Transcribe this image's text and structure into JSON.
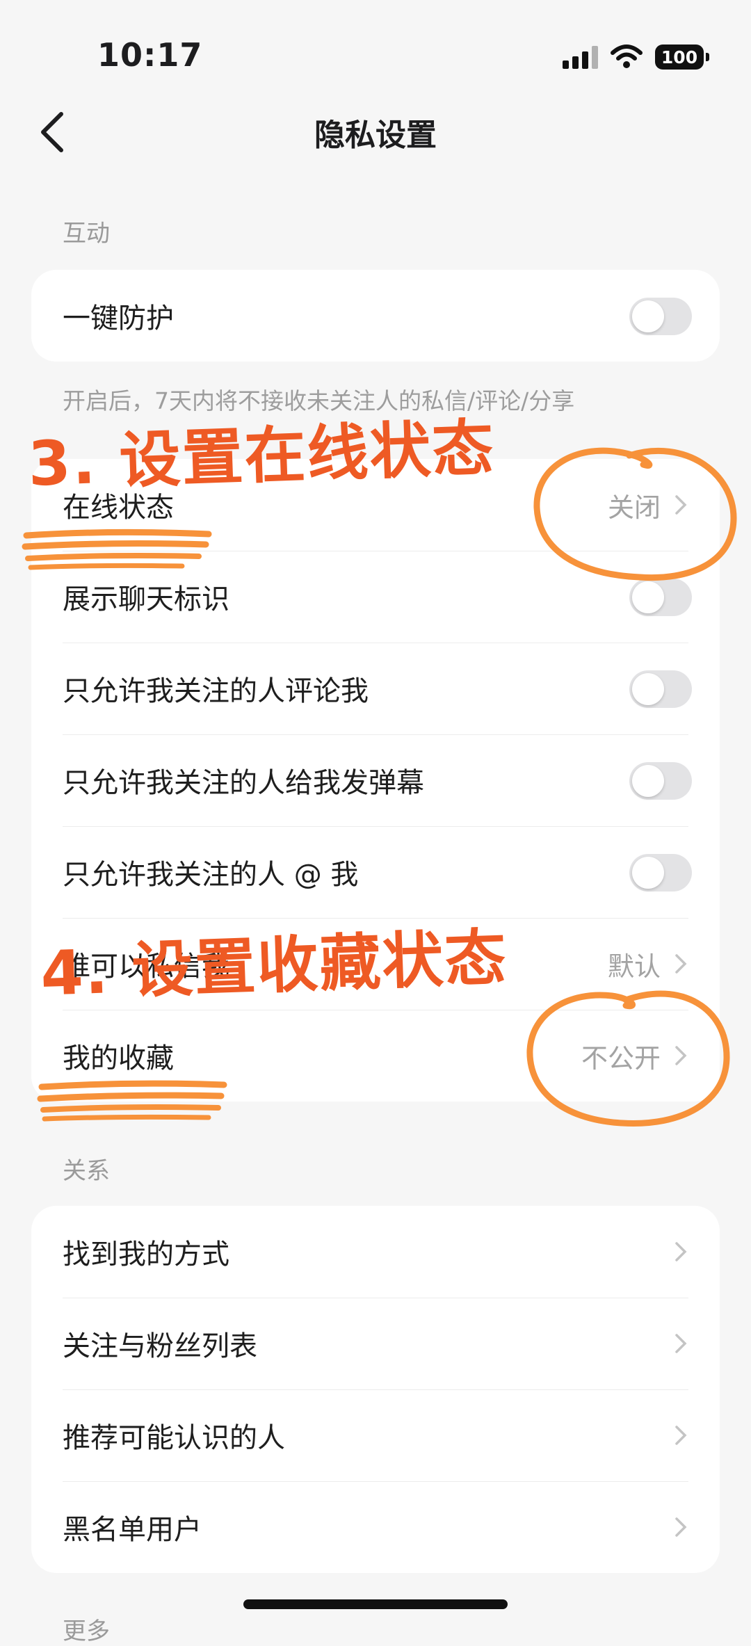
{
  "status_bar": {
    "time": "10:17",
    "battery": "100",
    "icons": [
      "signal-icon",
      "wifi-icon",
      "battery-icon"
    ]
  },
  "nav": {
    "title": "隐私设置",
    "back_icon": "chevron-left-icon"
  },
  "interaction": {
    "section_title": "互动",
    "protection": {
      "label": "一键防护",
      "enabled": false
    },
    "protection_helper": "开启后，7天内将不接收未关注人的私信/评论/分享",
    "items": [
      {
        "label": "在线状态",
        "value": "关闭",
        "type": "link"
      },
      {
        "label": "展示聊天标识",
        "type": "toggle",
        "enabled": false
      },
      {
        "label": "只允许我关注的人评论我",
        "type": "toggle",
        "enabled": false
      },
      {
        "label": "只允许我关注的人给我发弹幕",
        "type": "toggle",
        "enabled": false
      },
      {
        "label": "只允许我关注的人 @ 我",
        "type": "toggle",
        "enabled": false
      },
      {
        "label": "谁可以私信我",
        "value": "默认",
        "type": "link"
      },
      {
        "label": "我的收藏",
        "value": "不公开",
        "type": "link"
      }
    ]
  },
  "relations": {
    "section_title": "关系",
    "items": [
      {
        "label": "找到我的方式"
      },
      {
        "label": "关注与粉丝列表"
      },
      {
        "label": "推荐可能认识的人"
      },
      {
        "label": "黑名单用户"
      }
    ]
  },
  "more": {
    "section_title": "更多"
  },
  "annotations": {
    "step3": "3. 设置在线状态",
    "step4": "4. 设置收藏状态",
    "circle_color": "#f7923a",
    "text_color": "#ee5a24"
  }
}
